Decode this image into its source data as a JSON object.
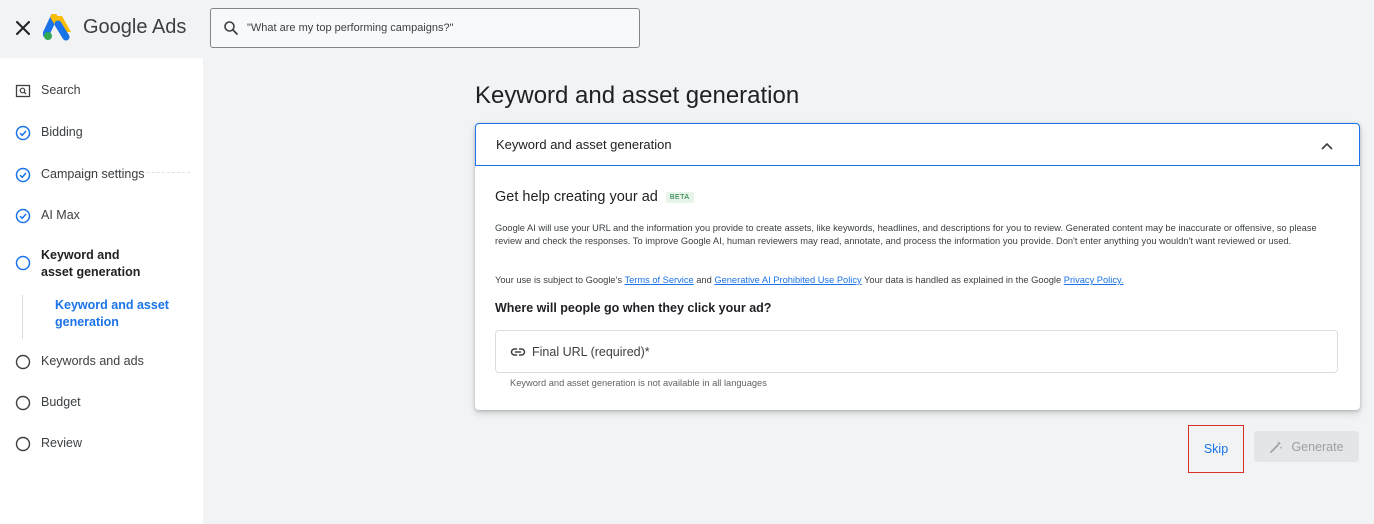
{
  "header": {
    "brand": "Google Ads",
    "search_placeholder": "\"What are my top performing campaigns?\""
  },
  "sidebar": {
    "search": "Search",
    "items": [
      {
        "label": "Bidding",
        "status": "done"
      },
      {
        "label": "Campaign settings",
        "status": "done"
      },
      {
        "label": "AI Max",
        "status": "done"
      },
      {
        "label": "Keyword and asset generation",
        "status": "current"
      },
      {
        "label": "Keywords and ads",
        "status": "todo"
      },
      {
        "label": "Budget",
        "status": "todo"
      },
      {
        "label": "Review",
        "status": "todo"
      }
    ],
    "sub_item": "Keyword and asset generation"
  },
  "main": {
    "page_title": "Keyword and asset generation",
    "panel_title": "Keyword and asset generation",
    "help_title": "Get help creating your ad",
    "beta": "BETA",
    "description": "Google AI will use your URL and the information you provide to create assets, like keywords, headlines, and descriptions for you to review. Generated content may be inaccurate or offensive, so please review and check the responses. To improve Google AI, human reviewers may read, annotate, and process the information you provide. Don't enter anything you wouldn't want reviewed or used.",
    "policy": {
      "prefix": "Your use is subject to Google's ",
      "terms_link": "Terms of Service",
      "and": " and ",
      "genai_link": "Generative AI Prohibited Use Policy",
      "middle": " Your data is handled as explained in the Google ",
      "privacy_link": "Privacy Policy."
    },
    "question": "Where will people go when they click your ad?",
    "url_placeholder": "Final URL (required)*",
    "hint": "Keyword and asset generation is not available in all languages"
  },
  "actions": {
    "skip": "Skip",
    "generate": "Generate"
  },
  "colors": {
    "accent": "#1a73e8",
    "highlight": "#d93025",
    "sidebar_bg": "#ffffff",
    "page_bg": "#f1f3f4"
  },
  "icons": {
    "close": "close-icon",
    "logo": "google-ads-logo",
    "search": "search-icon",
    "done": "check-circle-icon",
    "todo": "empty-circle-icon",
    "chevron": "chevron-up-icon",
    "link": "link-icon",
    "generate": "magic-wand-icon"
  }
}
